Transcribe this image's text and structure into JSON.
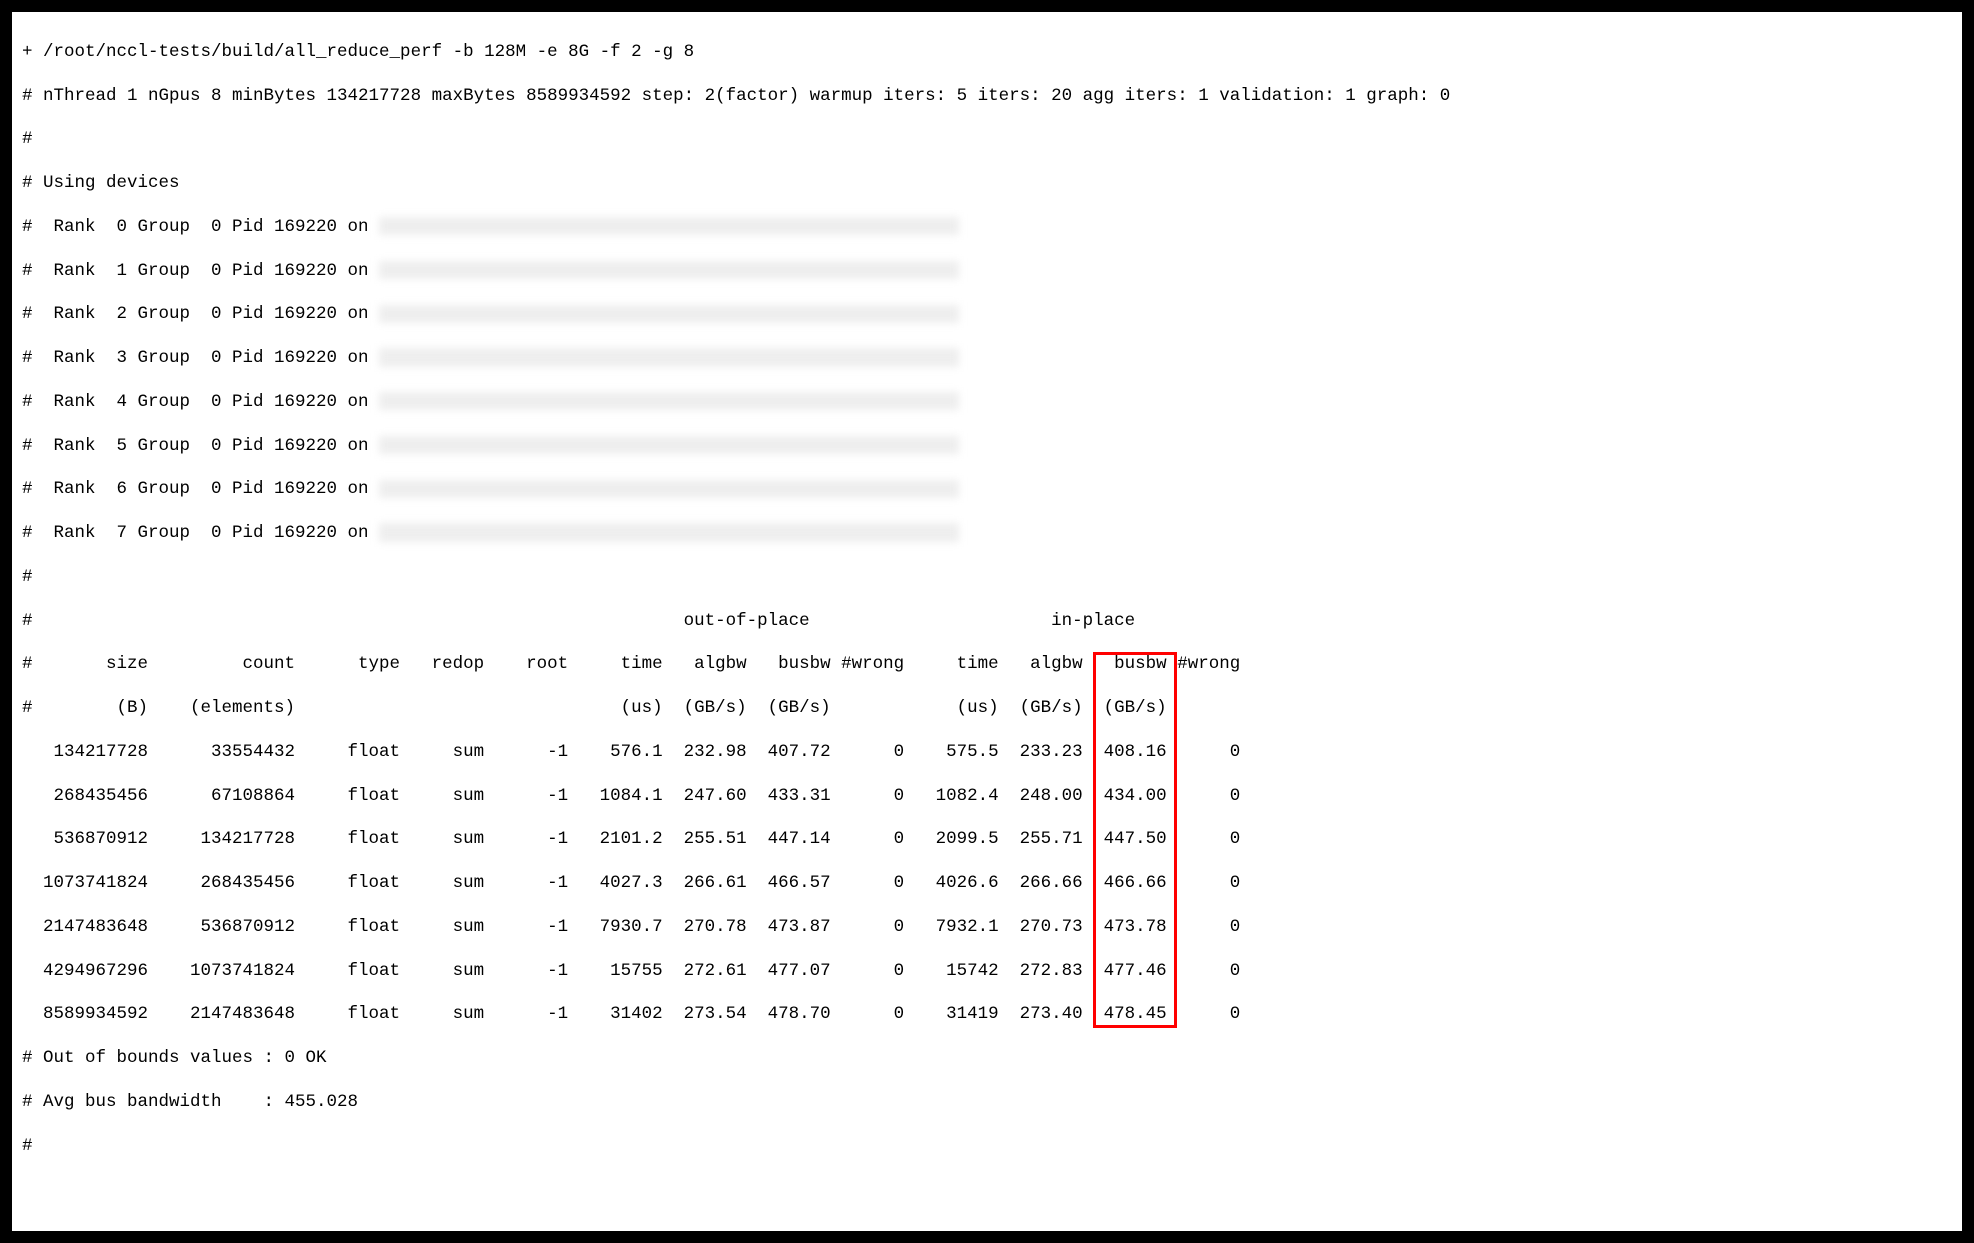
{
  "command": "+ /root/nccl-tests/build/all_reduce_perf -b 128M -e 8G -f 2 -g 8",
  "config": "# nThread 1 nGpus 8 minBytes 134217728 maxBytes 8589934592 step: 2(factor) warmup iters: 5 iters: 20 agg iters: 1 validation: 1 graph: 0",
  "using_devices": "# Using devices",
  "ranks": [
    "#  Rank  0 Group  0 Pid 169220 on ",
    "#  Rank  1 Group  0 Pid 169220 on ",
    "#  Rank  2 Group  0 Pid 169220 on ",
    "#  Rank  3 Group  0 Pid 169220 on ",
    "#  Rank  4 Group  0 Pid 169220 on ",
    "#  Rank  5 Group  0 Pid 169220 on ",
    "#  Rank  6 Group  0 Pid 169220 on ",
    "#  Rank  7 Group  0 Pid 169220 on "
  ],
  "section_header": "#                                                              out-of-place                       in-place          ",
  "col_header1": "#       size         count      type   redop    root     time   algbw   busbw #wrong     time   algbw   busbw #wrong",
  "col_header2": "#        (B)    (elements)                               (us)  (GB/s)  (GB/s)            (us)  (GB/s)  (GB/s)       ",
  "rows": [
    "   134217728      33554432     float     sum      -1    576.1  232.98  407.72      0    575.5  233.23  408.16      0",
    "   268435456      67108864     float     sum      -1   1084.1  247.60  433.31      0   1082.4  248.00  434.00      0",
    "   536870912     134217728     float     sum      -1   2101.2  255.51  447.14      0   2099.5  255.71  447.50      0",
    "  1073741824     268435456     float     sum      -1   4027.3  266.61  466.57      0   4026.6  266.66  466.66      0",
    "  2147483648     536870912     float     sum      -1   7930.7  270.78  473.87      0   7932.1  270.73  473.78      0",
    "  4294967296    1073741824     float     sum      -1    15755  272.61  477.07      0    15742  272.83  477.46      0",
    "  8589934592    2147483648     float     sum      -1    31402  273.54  478.70      0    31419  273.40  478.45      0"
  ],
  "footer1": "# Out of bounds values : 0 OK",
  "footer2": "# Avg bus bandwidth    : 455.028",
  "hash": "#",
  "chart_data": {
    "type": "table",
    "title": "NCCL all_reduce_perf benchmark output",
    "columns": [
      "size(B)",
      "count(elements)",
      "type",
      "redop",
      "root",
      "oop_time(us)",
      "oop_algbw(GB/s)",
      "oop_busbw(GB/s)",
      "oop_wrong",
      "ip_time(us)",
      "ip_algbw(GB/s)",
      "ip_busbw(GB/s)",
      "ip_wrong"
    ],
    "data": [
      [
        134217728,
        33554432,
        "float",
        "sum",
        -1,
        576.1,
        232.98,
        407.72,
        0,
        575.5,
        233.23,
        408.16,
        0
      ],
      [
        268435456,
        67108864,
        "float",
        "sum",
        -1,
        1084.1,
        247.6,
        433.31,
        0,
        1082.4,
        248.0,
        434.0,
        0
      ],
      [
        536870912,
        134217728,
        "float",
        "sum",
        -1,
        2101.2,
        255.51,
        447.14,
        0,
        2099.5,
        255.71,
        447.5,
        0
      ],
      [
        1073741824,
        268435456,
        "float",
        "sum",
        -1,
        4027.3,
        266.61,
        466.57,
        0,
        4026.6,
        266.66,
        466.66,
        0
      ],
      [
        2147483648,
        536870912,
        "float",
        "sum",
        -1,
        7930.7,
        270.78,
        473.87,
        0,
        7932.1,
        270.73,
        473.78,
        0
      ],
      [
        4294967296,
        1073741824,
        "float",
        "sum",
        -1,
        15755,
        272.61,
        477.07,
        0,
        15742,
        272.83,
        477.46,
        0
      ],
      [
        8589934592,
        2147483648,
        "float",
        "sum",
        -1,
        31402,
        273.54,
        478.7,
        0,
        31419,
        273.4,
        478.45,
        0
      ]
    ],
    "summary": {
      "out_of_bounds_values": "0 OK",
      "avg_bus_bandwidth": 455.028
    },
    "highlight": {
      "column": "ip_busbw(GB/s)",
      "color": "#ff0000"
    }
  }
}
